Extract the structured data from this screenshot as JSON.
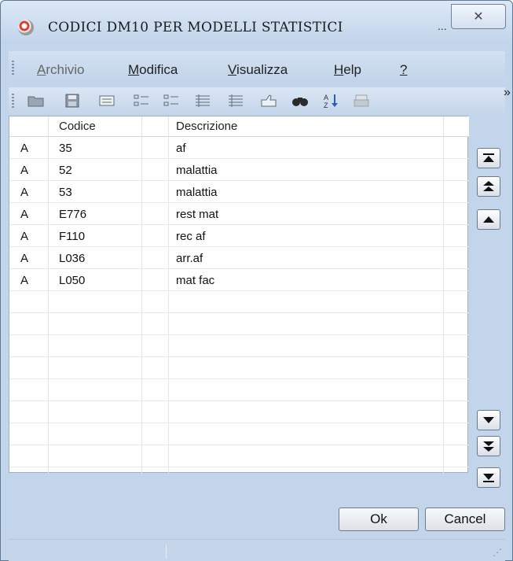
{
  "window": {
    "title": "CODICI DM10 PER MODELLI STATISTICI",
    "min_glyph": "...",
    "close_glyph": "✕"
  },
  "menu": {
    "items": [
      {
        "label": "Archivio",
        "mnemonic": "A",
        "rest": "rchivio"
      },
      {
        "label": "Modifica",
        "mnemonic": "M",
        "rest": "odifica"
      },
      {
        "label": "Visualizza",
        "mnemonic": "V",
        "rest": "isualizza"
      },
      {
        "label": "Help",
        "mnemonic": "H",
        "rest": "elp"
      },
      {
        "label": "?",
        "mnemonic": "?",
        "rest": ""
      }
    ]
  },
  "toolbar": {
    "icons": [
      "open-icon",
      "save-icon",
      "form-view-icon",
      "checklist-icon",
      "list-icon",
      "details-list-icon",
      "details-list-2-icon",
      "thumbs-icon",
      "find-icon",
      "sort-az-icon",
      "print-icon"
    ],
    "more_glyph": "»"
  },
  "grid": {
    "headers": [
      "Codice",
      "Descrizione"
    ],
    "rows": [
      {
        "flag": "A",
        "codice": "35",
        "descrizione": "af"
      },
      {
        "flag": "A",
        "codice": "52",
        "descrizione": "malattia"
      },
      {
        "flag": "A",
        "codice": "53",
        "descrizione": "malattia"
      },
      {
        "flag": "A",
        "codice": "E776",
        "descrizione": "rest mat"
      },
      {
        "flag": "A",
        "codice": "F110",
        "descrizione": "rec af"
      },
      {
        "flag": "A",
        "codice": "L036",
        "descrizione": "arr.af"
      },
      {
        "flag": "A",
        "codice": "L050",
        "descrizione": "mat fac"
      }
    ]
  },
  "navigation": [
    "first-icon",
    "page-up-icon",
    "up-icon",
    "down-icon",
    "page-down-icon",
    "last-icon"
  ],
  "buttons": {
    "ok": "Ok",
    "cancel": "Cancel"
  }
}
